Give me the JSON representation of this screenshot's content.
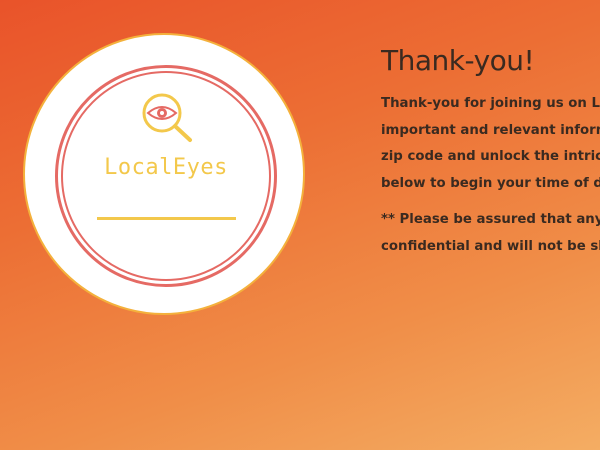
{
  "logo": {
    "name": "LocalEyes",
    "icon": "eye-magnifier-icon",
    "colors": {
      "text": "#f3c84b",
      "rings": "#e56a64",
      "border": "#f4b13c"
    }
  },
  "main": {
    "heading": "Thank-you!",
    "paragraph_lines": [
      "Thank-you for joining us on Lo",
      "important and relevant inform",
      "zip code and unlock the intrica",
      "below to begin your time of di"
    ],
    "notice_lines": [
      "** Please be assured that any i",
      "confidential and will not be sh"
    ]
  },
  "colors": {
    "background_start": "#e9532a",
    "background_end": "#f4ad63",
    "text": "#3a2a20"
  }
}
